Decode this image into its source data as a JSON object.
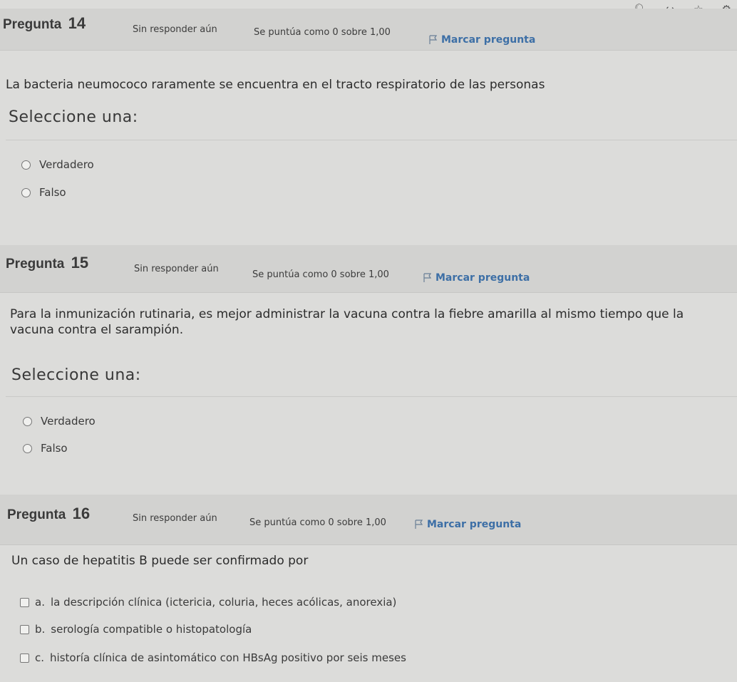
{
  "browser": {
    "icons": [
      "search-icon",
      "share-icon",
      "star-icon",
      "extension-icon"
    ]
  },
  "questions": [
    {
      "label": "Pregunta",
      "number": "14",
      "state": "Sin responder aún",
      "grade": "Se puntúa como 0 sobre 1,00",
      "flag": "Marcar pregunta",
      "text": "La bacteria neumococo raramente se encuentra en el tracto respiratorio de las personas",
      "prompt": "Seleccione una:",
      "options": [
        "Verdadero",
        "Falso"
      ]
    },
    {
      "label": "Pregunta",
      "number": "15",
      "state": "Sin responder aún",
      "grade": "Se puntúa como 0 sobre 1,00",
      "flag": "Marcar pregunta",
      "text": "Para la inmunización rutinaria, es mejor administrar la vacuna contra la fiebre amarilla al mismo tiempo que la vacuna contra el sarampión.",
      "prompt": "Seleccione una:",
      "options": [
        "Verdadero",
        "Falso"
      ]
    },
    {
      "label": "Pregunta",
      "number": "16",
      "state": "Sin responder aún",
      "grade": "Se puntúa como 0 sobre 1,00",
      "flag": "Marcar pregunta",
      "text": "Un caso de hepatitis B puede ser confirmado por",
      "options": [
        {
          "letter": "a.",
          "text": "la descripción clínica (ictericia, coluria, heces acólicas, anorexia)"
        },
        {
          "letter": "b.",
          "text": "serología compatible o histopatología"
        },
        {
          "letter": "c.",
          "text": "historía clínica de asintomático con HBsAg positivo por seis meses"
        }
      ]
    }
  ]
}
